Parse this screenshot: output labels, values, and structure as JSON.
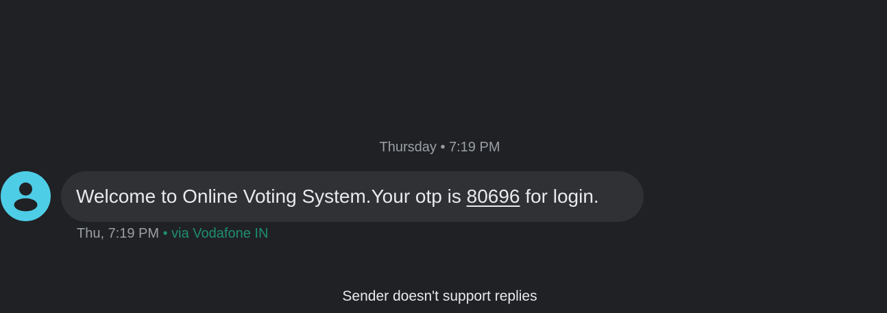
{
  "thread": {
    "date_divider": "Thursday • 7:19 PM",
    "message": {
      "sender_avatar_icon": "person-icon",
      "text_before_otp": "Welcome to Online Voting System.Your otp is ",
      "otp": "80696",
      "text_after_otp": " for login.",
      "timestamp": "Thu, 7:19 PM",
      "carrier": " • via Vodafone IN"
    },
    "footer_notice": "Sender doesn't support replies"
  },
  "colors": {
    "background": "#202124",
    "bubble": "#303134",
    "avatar": "#4ecde6",
    "carrier_text": "#1e8e73",
    "secondary_text": "#9aa0a6",
    "primary_text": "#e8eaed"
  }
}
